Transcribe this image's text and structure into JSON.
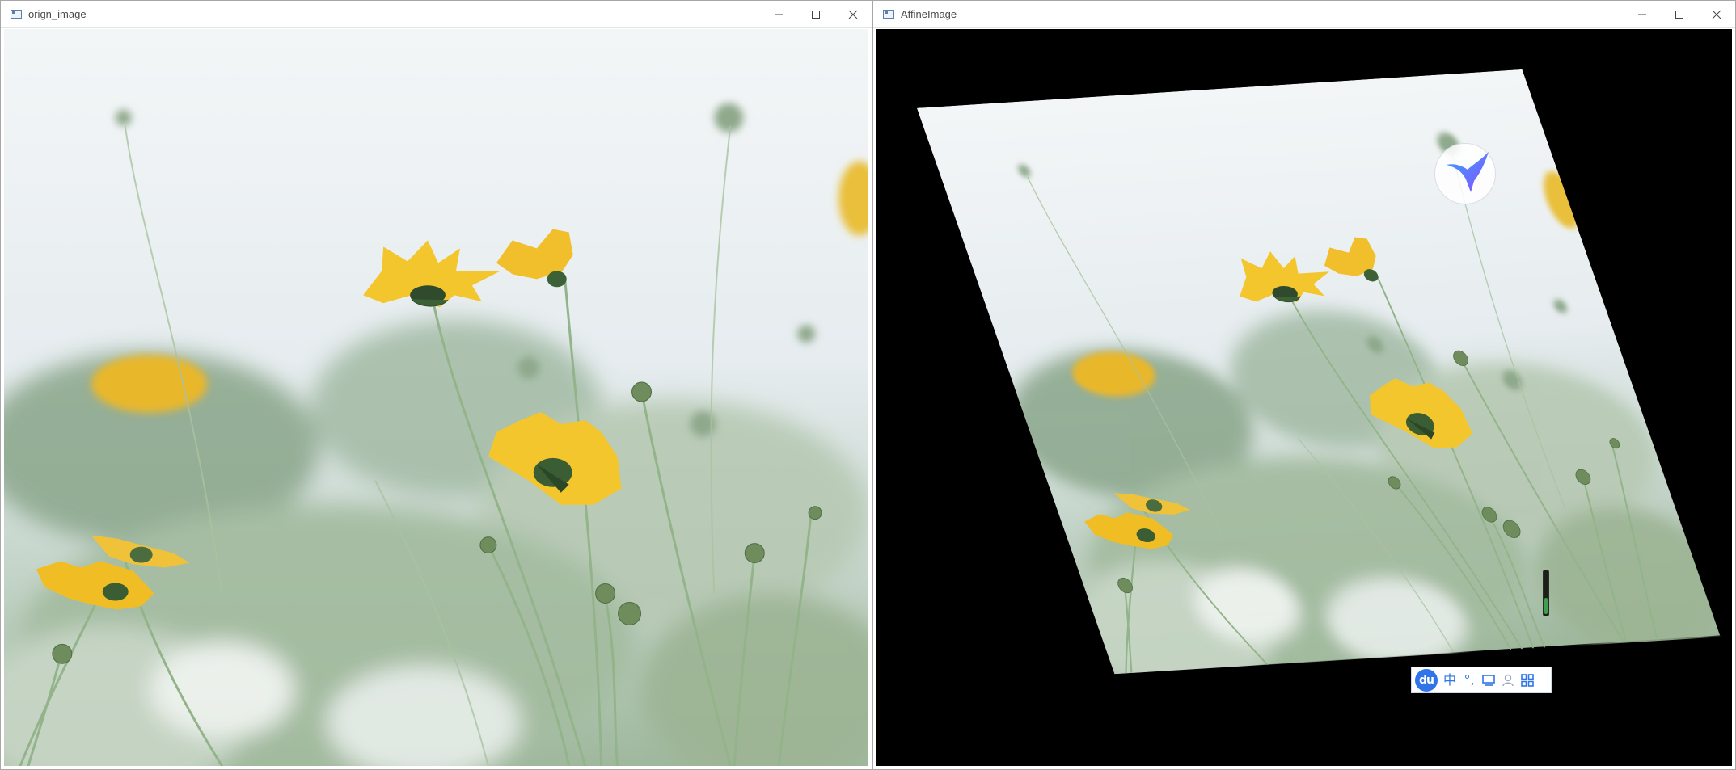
{
  "windows": [
    {
      "id": "origin",
      "title": "orign_image",
      "controls": {
        "minimize": "minimize",
        "maximize": "maximize",
        "close": "close"
      }
    },
    {
      "id": "affine",
      "title": "AffineImage",
      "controls": {
        "minimize": "minimize",
        "maximize": "maximize",
        "close": "close"
      }
    }
  ],
  "ime_toolbar": {
    "logo": "du",
    "items": [
      {
        "name": "chinese-mode",
        "label": "中"
      },
      {
        "name": "punctuation",
        "label": "°,"
      },
      {
        "name": "keyboard-icon",
        "label": ""
      },
      {
        "name": "user-icon",
        "label": ""
      },
      {
        "name": "grid-icon",
        "label": ""
      }
    ]
  },
  "colors": {
    "accent": "#2f74e8",
    "flower_yellow": "#f2c530",
    "stem_green": "#8fb186",
    "sky": "#eef2f3",
    "background_black": "#000000"
  },
  "icons": {
    "window_app": "window-app-icon",
    "floating_badge": "hummingbird-icon"
  }
}
